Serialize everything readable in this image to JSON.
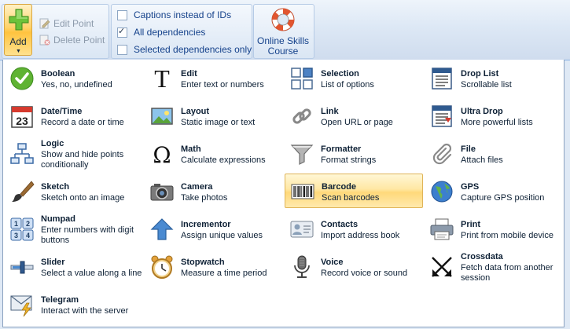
{
  "ribbon": {
    "add_label": "Add",
    "edit_point_label": "Edit Point",
    "delete_point_label": "Delete Point",
    "checkboxes": [
      {
        "label": "Captions instead of IDs",
        "checked": false
      },
      {
        "label": "All dependencies",
        "checked": true
      },
      {
        "label": "Selected dependencies only",
        "checked": false
      }
    ],
    "online_label_line1": "Online Skills",
    "online_label_line2": "Course"
  },
  "menu": {
    "selected": "Barcode",
    "items": [
      {
        "title": "Boolean",
        "desc": "Yes, no, undefined",
        "icon": "checkmark-icon"
      },
      {
        "title": "Edit",
        "desc": "Enter text or numbers",
        "icon": "text-icon"
      },
      {
        "title": "Selection",
        "desc": "List of options",
        "icon": "grid-icon"
      },
      {
        "title": "Drop List",
        "desc": "Scrollable list",
        "icon": "list-icon"
      },
      {
        "title": "Date/Time",
        "desc": "Record a date or time",
        "icon": "calendar-icon"
      },
      {
        "title": "Layout",
        "desc": "Static image or text",
        "icon": "image-icon"
      },
      {
        "title": "Link",
        "desc": "Open URL or page",
        "icon": "chain-link-icon"
      },
      {
        "title": "Ultra Drop",
        "desc": "More powerful lists",
        "icon": "ultra-list-icon"
      },
      {
        "title": "Logic",
        "desc": "Show and hide points conditionally",
        "icon": "flowchart-icon"
      },
      {
        "title": "Math",
        "desc": "Calculate expressions",
        "icon": "omega-icon"
      },
      {
        "title": "Formatter",
        "desc": "Format strings",
        "icon": "funnel-icon"
      },
      {
        "title": "File",
        "desc": "Attach files",
        "icon": "paperclip-icon"
      },
      {
        "title": "Sketch",
        "desc": "Sketch onto an image",
        "icon": "brush-icon"
      },
      {
        "title": "Camera",
        "desc": "Take photos",
        "icon": "camera-icon"
      },
      {
        "title": "Barcode",
        "desc": "Scan barcodes",
        "icon": "barcode-icon"
      },
      {
        "title": "GPS",
        "desc": "Capture GPS position",
        "icon": "globe-icon"
      },
      {
        "title": "Numpad",
        "desc": "Enter numbers with digit buttons",
        "icon": "numpad-icon"
      },
      {
        "title": "Incrementor",
        "desc": "Assign unique values",
        "icon": "arrow-up-icon"
      },
      {
        "title": "Contacts",
        "desc": "Import address book",
        "icon": "contact-card-icon"
      },
      {
        "title": "Print",
        "desc": "Print from mobile device",
        "icon": "printer-icon"
      },
      {
        "title": "Slider",
        "desc": "Select a value along a line",
        "icon": "slider-icon"
      },
      {
        "title": "Stopwatch",
        "desc": "Measure a time period",
        "icon": "alarm-clock-icon"
      },
      {
        "title": "Voice",
        "desc": "Record voice or sound",
        "icon": "microphone-icon"
      },
      {
        "title": "Crossdata",
        "desc": "Fetch data from another session",
        "icon": "crossing-arrows-icon"
      },
      {
        "title": "Telegram",
        "desc": "Interact with the server",
        "icon": "envelope-lightning-icon"
      }
    ]
  }
}
